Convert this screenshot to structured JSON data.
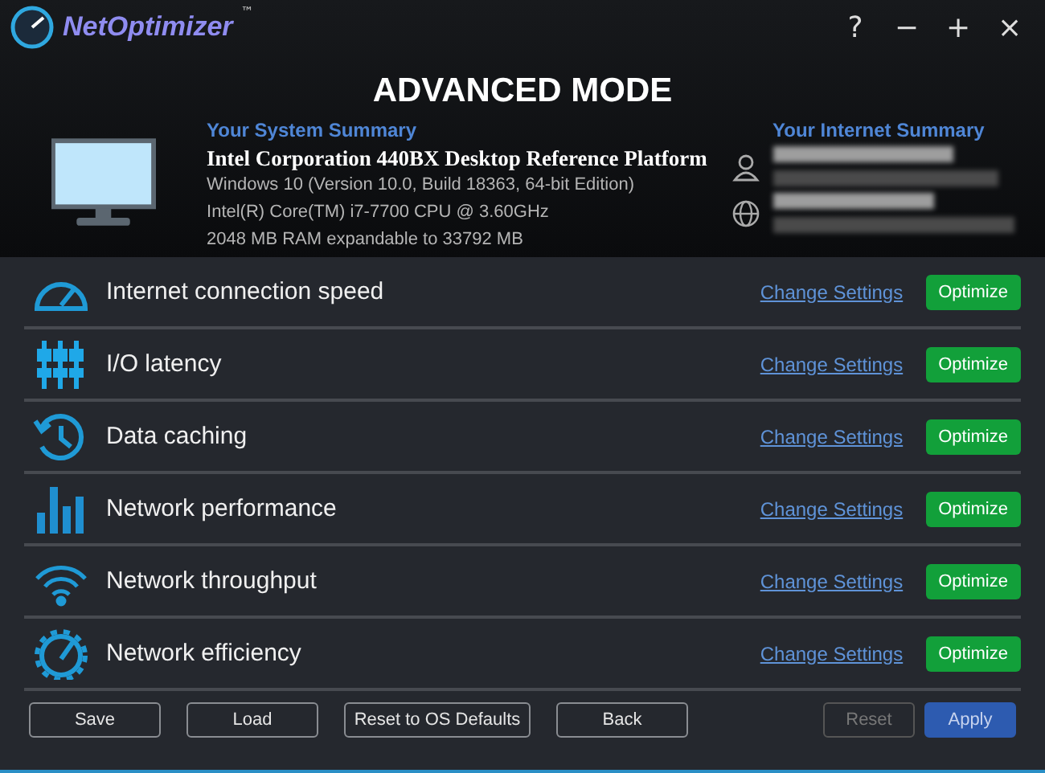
{
  "window": {
    "logo": "NetOptimizer",
    "trademark": "™",
    "controls": [
      "?",
      "−",
      "+",
      "×"
    ]
  },
  "title": "ADVANCED MODE",
  "system_summary": {
    "heading": "Your System Summary",
    "lines": [
      "Intel Corporation 440BX Desktop Reference Platform",
      "Windows 10 (Version 10.0, Build 18363, 64-bit Edition)",
      "Intel(R) Core(TM) i7-7700 CPU @ 3.60GHz",
      "2048 MB RAM expandable to 33792 MB"
    ]
  },
  "internet_summary": {
    "heading": "Your Internet Summary"
  },
  "items": [
    {
      "kind": "speed",
      "label": "Internet connection speed",
      "link": "Change Settings",
      "button": "Optimize"
    },
    {
      "kind": "latency",
      "label": "I/O latency",
      "link": "Change Settings",
      "button": "Optimize"
    },
    {
      "kind": "caching",
      "label": "Data caching",
      "link": "Change Settings",
      "button": "Optimize"
    },
    {
      "kind": "performance",
      "label": "Network performance",
      "link": "Change Settings",
      "button": "Optimize"
    },
    {
      "kind": "throughput",
      "label": "Network throughput",
      "link": "Change Settings",
      "button": "Optimize"
    },
    {
      "kind": "efficiency",
      "label": "Network efficiency",
      "link": "Change Settings",
      "button": "Optimize"
    }
  ],
  "footer_left": [
    {
      "label": "Save",
      "disabled": false
    },
    {
      "label": "Load",
      "disabled": false
    },
    {
      "label": "Reset to OS Defaults",
      "disabled": false
    },
    {
      "label": "Back",
      "disabled": false
    }
  ],
  "footer_right": [
    {
      "label": "Reset",
      "disabled": true,
      "kind": "plain"
    },
    {
      "label": "Apply",
      "disabled": false,
      "kind": "primary"
    }
  ]
}
